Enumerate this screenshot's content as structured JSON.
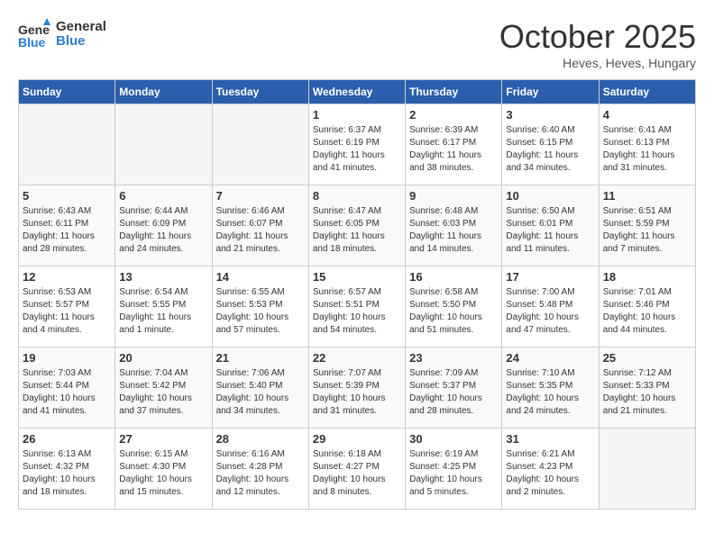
{
  "header": {
    "logo_line1": "General",
    "logo_line2": "Blue",
    "month": "October 2025",
    "location": "Heves, Heves, Hungary"
  },
  "weekdays": [
    "Sunday",
    "Monday",
    "Tuesday",
    "Wednesday",
    "Thursday",
    "Friday",
    "Saturday"
  ],
  "weeks": [
    [
      {
        "day": "",
        "empty": true
      },
      {
        "day": "",
        "empty": true
      },
      {
        "day": "",
        "empty": true
      },
      {
        "day": "1",
        "sunrise": "6:37 AM",
        "sunset": "6:19 PM",
        "daylight": "11 hours and 41 minutes."
      },
      {
        "day": "2",
        "sunrise": "6:39 AM",
        "sunset": "6:17 PM",
        "daylight": "11 hours and 38 minutes."
      },
      {
        "day": "3",
        "sunrise": "6:40 AM",
        "sunset": "6:15 PM",
        "daylight": "11 hours and 34 minutes."
      },
      {
        "day": "4",
        "sunrise": "6:41 AM",
        "sunset": "6:13 PM",
        "daylight": "11 hours and 31 minutes."
      }
    ],
    [
      {
        "day": "5",
        "sunrise": "6:43 AM",
        "sunset": "6:11 PM",
        "daylight": "11 hours and 28 minutes."
      },
      {
        "day": "6",
        "sunrise": "6:44 AM",
        "sunset": "6:09 PM",
        "daylight": "11 hours and 24 minutes."
      },
      {
        "day": "7",
        "sunrise": "6:46 AM",
        "sunset": "6:07 PM",
        "daylight": "11 hours and 21 minutes."
      },
      {
        "day": "8",
        "sunrise": "6:47 AM",
        "sunset": "6:05 PM",
        "daylight": "11 hours and 18 minutes."
      },
      {
        "day": "9",
        "sunrise": "6:48 AM",
        "sunset": "6:03 PM",
        "daylight": "11 hours and 14 minutes."
      },
      {
        "day": "10",
        "sunrise": "6:50 AM",
        "sunset": "6:01 PM",
        "daylight": "11 hours and 11 minutes."
      },
      {
        "day": "11",
        "sunrise": "6:51 AM",
        "sunset": "5:59 PM",
        "daylight": "11 hours and 7 minutes."
      }
    ],
    [
      {
        "day": "12",
        "sunrise": "6:53 AM",
        "sunset": "5:57 PM",
        "daylight": "11 hours and 4 minutes."
      },
      {
        "day": "13",
        "sunrise": "6:54 AM",
        "sunset": "5:55 PM",
        "daylight": "11 hours and 1 minute."
      },
      {
        "day": "14",
        "sunrise": "6:55 AM",
        "sunset": "5:53 PM",
        "daylight": "10 hours and 57 minutes."
      },
      {
        "day": "15",
        "sunrise": "6:57 AM",
        "sunset": "5:51 PM",
        "daylight": "10 hours and 54 minutes."
      },
      {
        "day": "16",
        "sunrise": "6:58 AM",
        "sunset": "5:50 PM",
        "daylight": "10 hours and 51 minutes."
      },
      {
        "day": "17",
        "sunrise": "7:00 AM",
        "sunset": "5:48 PM",
        "daylight": "10 hours and 47 minutes."
      },
      {
        "day": "18",
        "sunrise": "7:01 AM",
        "sunset": "5:46 PM",
        "daylight": "10 hours and 44 minutes."
      }
    ],
    [
      {
        "day": "19",
        "sunrise": "7:03 AM",
        "sunset": "5:44 PM",
        "daylight": "10 hours and 41 minutes."
      },
      {
        "day": "20",
        "sunrise": "7:04 AM",
        "sunset": "5:42 PM",
        "daylight": "10 hours and 37 minutes."
      },
      {
        "day": "21",
        "sunrise": "7:06 AM",
        "sunset": "5:40 PM",
        "daylight": "10 hours and 34 minutes."
      },
      {
        "day": "22",
        "sunrise": "7:07 AM",
        "sunset": "5:39 PM",
        "daylight": "10 hours and 31 minutes."
      },
      {
        "day": "23",
        "sunrise": "7:09 AM",
        "sunset": "5:37 PM",
        "daylight": "10 hours and 28 minutes."
      },
      {
        "day": "24",
        "sunrise": "7:10 AM",
        "sunset": "5:35 PM",
        "daylight": "10 hours and 24 minutes."
      },
      {
        "day": "25",
        "sunrise": "7:12 AM",
        "sunset": "5:33 PM",
        "daylight": "10 hours and 21 minutes."
      }
    ],
    [
      {
        "day": "26",
        "sunrise": "6:13 AM",
        "sunset": "4:32 PM",
        "daylight": "10 hours and 18 minutes."
      },
      {
        "day": "27",
        "sunrise": "6:15 AM",
        "sunset": "4:30 PM",
        "daylight": "10 hours and 15 minutes."
      },
      {
        "day": "28",
        "sunrise": "6:16 AM",
        "sunset": "4:28 PM",
        "daylight": "10 hours and 12 minutes."
      },
      {
        "day": "29",
        "sunrise": "6:18 AM",
        "sunset": "4:27 PM",
        "daylight": "10 hours and 8 minutes."
      },
      {
        "day": "30",
        "sunrise": "6:19 AM",
        "sunset": "4:25 PM",
        "daylight": "10 hours and 5 minutes."
      },
      {
        "day": "31",
        "sunrise": "6:21 AM",
        "sunset": "4:23 PM",
        "daylight": "10 hours and 2 minutes."
      },
      {
        "day": "",
        "empty": true
      }
    ]
  ]
}
